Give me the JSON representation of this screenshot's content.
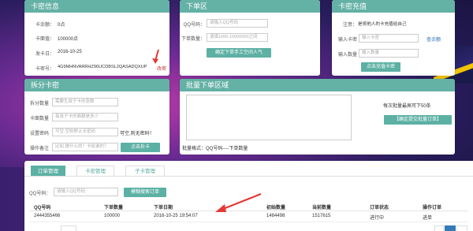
{
  "card_info": {
    "title": "卡密信息",
    "balance_label": "卡余额：",
    "balance_value": "0点",
    "face_label": "卡面值：",
    "face_value": "100000点",
    "issue_label": "发卡日：",
    "issue_value": "2016-10-25",
    "code_label": "卡密号：",
    "code_value": "4G9MHNVARRHZ96UCDBSL2QASADQXUP",
    "change_link": "改密"
  },
  "order": {
    "title": "下单区",
    "qq_label": "QQ号码：",
    "qq_placeholder": "请输入QQ号码",
    "qty_label": "下单数量：",
    "qty_placeholder": "请填1000-10000000之间",
    "submit_label": "确定下单手工空间人气"
  },
  "recharge": {
    "title": "卡密充值",
    "note_label": "注意：",
    "note_text": "是将他人的卡充值给自己",
    "card_label": "输入卡密",
    "card_placeholder": "输入卡密",
    "balance_link": "查余额",
    "qty_label": "输入数量",
    "qty_placeholder": "输入数量",
    "submit_label": "点击充值卡密"
  },
  "split": {
    "title": "拆分卡密",
    "count_label": "拆分数量",
    "count_placeholder": "需要生成子卡的张数",
    "face_label": "卡面数量",
    "face_placeholder": "每张子卡的面额是多少",
    "pwd_label": "设置密码",
    "pwd_placeholder": "可空,空则默认无密码",
    "pwd_hint": "可空,则无密码！",
    "note_label": "操作备注",
    "note_placeholder": "比如,做什么的？卡给谁的？",
    "submit_label": "点击拆卡"
  },
  "batch": {
    "title": "批量下单区域",
    "hint": "每次批量最高可下50条",
    "submit_label": "【确定提交批量订单】",
    "format_text": "批量格式：QQ号码----下单数量"
  },
  "tabs": [
    "订单管理",
    "卡密管理",
    "子卡管理"
  ],
  "search": {
    "label": "QQ号码：",
    "placeholder": "请输入QQ号码",
    "button_label": "模糊搜索订单"
  },
  "table": {
    "headers": [
      "QQ号码",
      "下单数量",
      "下单日期",
      "初始数量",
      "当前数量",
      "订单状态",
      "操作订单"
    ],
    "rows": [
      [
        "2444355466",
        "100000",
        "2016-10-25 19:54:07",
        "1484498",
        "1517615",
        "进行中",
        "进单"
      ]
    ]
  },
  "colors": {
    "panel_header": "#64b1a5",
    "button": "#5cb0a4",
    "arrow": "#e53935",
    "link": "#2e6fb8"
  }
}
